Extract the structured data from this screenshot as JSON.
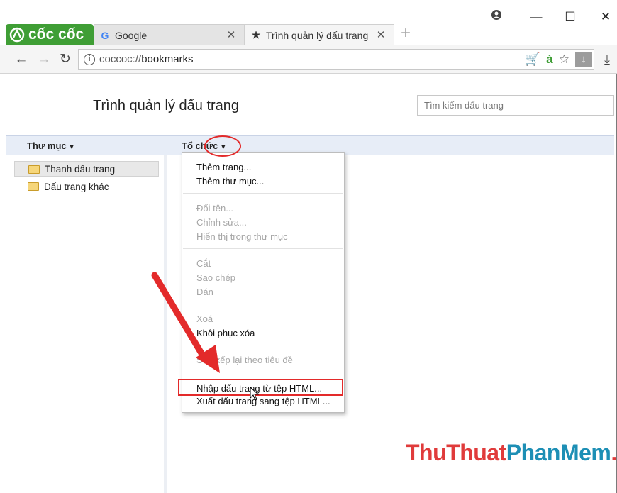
{
  "browser": {
    "brand": "cốc cốc",
    "tabs": [
      {
        "title": "Google",
        "icon": "google-g-icon",
        "active": false
      },
      {
        "title": "Trình quản lý dấu trang",
        "icon": "star-icon",
        "active": true
      }
    ],
    "url_scheme": "coccoc://",
    "url_host": "bookmarks"
  },
  "page": {
    "title": "Trình quản lý dấu trang",
    "search_placeholder": "Tìm kiếm dấu trang",
    "folders_header": "Thư mục",
    "organize_header": "Tổ chức",
    "folders": [
      "Thanh dấu trang",
      "Dấu trang khác"
    ]
  },
  "menu": {
    "groups": [
      [
        {
          "label": "Thêm trang...",
          "enabled": true
        },
        {
          "label": "Thêm thư mục...",
          "enabled": true
        }
      ],
      [
        {
          "label": "Đổi tên...",
          "enabled": false
        },
        {
          "label": "Chỉnh sửa...",
          "enabled": false
        },
        {
          "label": "Hiển thị trong thư mục",
          "enabled": false
        }
      ],
      [
        {
          "label": "Cắt",
          "enabled": false
        },
        {
          "label": "Sao chép",
          "enabled": false
        },
        {
          "label": "Dán",
          "enabled": false
        }
      ],
      [
        {
          "label": "Xoá",
          "enabled": false
        },
        {
          "label": "Khôi phục xóa",
          "enabled": true
        }
      ],
      [
        {
          "label": "Sắp xếp lại theo tiêu đề",
          "enabled": false
        }
      ],
      [
        {
          "label": "Nhập dấu trang từ tệp HTML...",
          "enabled": true
        },
        {
          "label": "Xuất dấu trang sang tệp HTML...",
          "enabled": true
        }
      ]
    ]
  },
  "watermark": {
    "part1": "ThuThuat",
    "part2": "PhanMem",
    "part3": ".vn"
  },
  "colors": {
    "brand_green": "#3f9e35",
    "annotation_red": "#e32a2a",
    "header_bar": "#e7edf7"
  }
}
